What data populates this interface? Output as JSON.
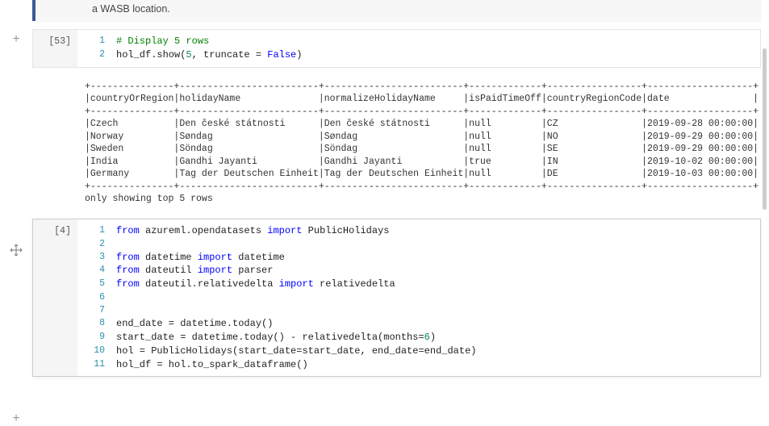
{
  "topbar": {
    "text": "a WASB location."
  },
  "cells": [
    {
      "prompt": "[53]",
      "lines": [
        {
          "n": "1",
          "tokens": [
            {
              "t": "# Display 5 rows",
              "c": "c-comment"
            }
          ]
        },
        {
          "n": "2",
          "tokens": [
            {
              "t": "hol_df.show(",
              "c": "c-ident"
            },
            {
              "t": "5",
              "c": "c-num"
            },
            {
              "t": ", truncate = ",
              "c": "c-ident"
            },
            {
              "t": "False",
              "c": "c-keyword"
            },
            {
              "t": ")",
              "c": "c-ident"
            }
          ]
        }
      ]
    },
    {
      "prompt": "[4]",
      "lines": [
        {
          "n": "1",
          "tokens": [
            {
              "t": "from",
              "c": "c-keyword"
            },
            {
              "t": " azureml.opendatasets ",
              "c": "c-ident"
            },
            {
              "t": "import",
              "c": "c-keyword"
            },
            {
              "t": " PublicHolidays",
              "c": "c-ident"
            }
          ]
        },
        {
          "n": "2",
          "tokens": []
        },
        {
          "n": "3",
          "tokens": [
            {
              "t": "from",
              "c": "c-keyword"
            },
            {
              "t": " datetime ",
              "c": "c-ident"
            },
            {
              "t": "import",
              "c": "c-keyword"
            },
            {
              "t": " datetime",
              "c": "c-ident"
            }
          ]
        },
        {
          "n": "4",
          "tokens": [
            {
              "t": "from",
              "c": "c-keyword"
            },
            {
              "t": " dateutil ",
              "c": "c-ident"
            },
            {
              "t": "import",
              "c": "c-keyword"
            },
            {
              "t": " parser",
              "c": "c-ident"
            }
          ]
        },
        {
          "n": "5",
          "tokens": [
            {
              "t": "from",
              "c": "c-keyword"
            },
            {
              "t": " dateutil.relativedelta ",
              "c": "c-ident"
            },
            {
              "t": "import",
              "c": "c-keyword"
            },
            {
              "t": " relativedelta",
              "c": "c-ident"
            }
          ]
        },
        {
          "n": "6",
          "tokens": []
        },
        {
          "n": "7",
          "tokens": []
        },
        {
          "n": "8",
          "tokens": [
            {
              "t": "end_date = datetime.today()",
              "c": "c-ident"
            }
          ]
        },
        {
          "n": "9",
          "tokens": [
            {
              "t": "start_date = datetime.today() - relativedelta(months=",
              "c": "c-ident"
            },
            {
              "t": "6",
              "c": "c-num"
            },
            {
              "t": ")",
              "c": "c-ident"
            }
          ]
        },
        {
          "n": "10",
          "tokens": [
            {
              "t": "hol = PublicHolidays(start_date=start_date, end_date=end_date)",
              "c": "c-ident"
            }
          ]
        },
        {
          "n": "11",
          "tokens": [
            {
              "t": "hol_df = hol.to_spark_dataframe()",
              "c": "c-ident"
            }
          ]
        }
      ]
    }
  ],
  "output": {
    "sep": "+---------------+-------------------------+-------------------------+-------------+-----------------+-------------------+",
    "header": "|countryOrRegion|holidayName              |normalizeHolidayName     |isPaidTimeOff|countryRegionCode|date               |",
    "rows": [
      "|Czech          |Den české státnosti      |Den české státnosti      |null         |CZ               |2019-09-28 00:00:00|",
      "|Norway         |Søndag                   |Søndag                   |null         |NO               |2019-09-29 00:00:00|",
      "|Sweden         |Söndag                   |Söndag                   |null         |SE               |2019-09-29 00:00:00|",
      "|India          |Gandhi Jayanti           |Gandhi Jayanti           |true         |IN               |2019-10-02 00:00:00|",
      "|Germany        |Tag der Deutschen Einheit|Tag der Deutschen Einheit|null         |DE               |2019-10-03 00:00:00|"
    ],
    "footer": "only showing top 5 rows"
  },
  "icons": {
    "add": "+",
    "move": "✥"
  }
}
